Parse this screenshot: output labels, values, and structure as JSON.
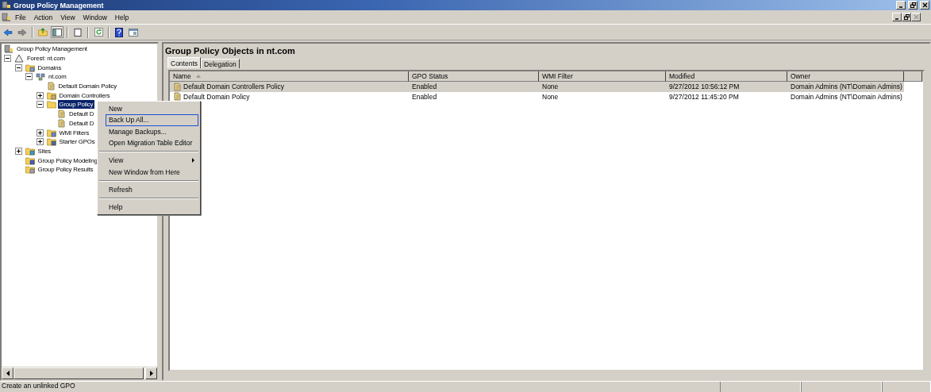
{
  "window": {
    "title": "Group Policy Management"
  },
  "menu_bar": [
    "File",
    "Action",
    "View",
    "Window",
    "Help"
  ],
  "toolbar": [
    {
      "kind": "back"
    },
    {
      "kind": "forward"
    },
    {
      "kind": "separator"
    },
    {
      "kind": "up"
    },
    {
      "kind": "tree",
      "pressed": true
    },
    {
      "kind": "separator"
    },
    {
      "kind": "properties"
    },
    {
      "kind": "separator"
    },
    {
      "kind": "refresh"
    },
    {
      "kind": "separator"
    },
    {
      "kind": "help"
    },
    {
      "kind": "console"
    }
  ],
  "tree": [
    {
      "label": "Group Policy Management",
      "kind": "root",
      "selected": false,
      "children": [
        {
          "label": "Forest: nt.com",
          "kind": "forest",
          "selected": false,
          "expanded": true,
          "children": [
            {
              "label": "Domains",
              "kind": "domains",
              "selected": false,
              "expanded": true,
              "children": [
                {
                  "label": "nt.com",
                  "kind": "domain",
                  "selected": false,
                  "expanded": true,
                  "children": [
                    {
                      "label": "Default Domain Policy",
                      "kind": "link",
                      "selected": false
                    },
                    {
                      "label": "Domain Controllers",
                      "kind": "ou",
                      "selected": false,
                      "expanded": false
                    },
                    {
                      "label": "Group Policy",
                      "kind": "folder",
                      "selected": true,
                      "expanded": true,
                      "children": [
                        {
                          "label": "Default D",
                          "kind": "gpo",
                          "selected": false
                        },
                        {
                          "label": "Default D",
                          "kind": "gpo",
                          "selected": false
                        }
                      ]
                    },
                    {
                      "label": "WMI Filters",
                      "kind": "wmi",
                      "selected": false,
                      "expanded": false
                    },
                    {
                      "label": "Starter GPOs",
                      "kind": "starter",
                      "selected": false,
                      "expanded": false
                    }
                  ]
                }
              ]
            },
            {
              "label": "Sites",
              "kind": "sites",
              "selected": false,
              "expanded": false
            },
            {
              "label": "Group Policy Modeling",
              "kind": "modeling",
              "selected": false
            },
            {
              "label": "Group Policy Results",
              "kind": "results",
              "selected": false
            }
          ]
        }
      ]
    }
  ],
  "context_menu": [
    {
      "kind": "item",
      "label": "New",
      "focused": false,
      "submenu": false
    },
    {
      "kind": "item",
      "label": "Back Up All...",
      "focused": true,
      "submenu": false
    },
    {
      "kind": "item",
      "label": "Manage Backups...",
      "focused": false,
      "submenu": false
    },
    {
      "kind": "item",
      "label": "Open Migration Table Editor",
      "focused": false,
      "submenu": false
    },
    {
      "kind": "separator"
    },
    {
      "kind": "item",
      "label": "View",
      "focused": false,
      "submenu": true
    },
    {
      "kind": "item",
      "label": "New Window from Here",
      "focused": false,
      "submenu": false
    },
    {
      "kind": "separator"
    },
    {
      "kind": "item",
      "label": "Refresh",
      "focused": false,
      "submenu": false
    },
    {
      "kind": "separator"
    },
    {
      "kind": "item",
      "label": "Help",
      "focused": false,
      "submenu": false
    }
  ],
  "details": {
    "title": "Group Policy Objects in nt.com",
    "tabs": [
      {
        "label": "Contents",
        "selected": true
      },
      {
        "label": "Delegation",
        "selected": false
      }
    ],
    "columns": [
      {
        "label": "Name",
        "sorted": true
      },
      {
        "label": "GPO Status",
        "sorted": false
      },
      {
        "label": "WMI Filter",
        "sorted": false
      },
      {
        "label": "Modified",
        "sorted": false
      },
      {
        "label": "Owner",
        "sorted": false
      }
    ],
    "rows": [
      {
        "selected": true,
        "cells": [
          "Default Domain Controllers Policy",
          "Enabled",
          "None",
          "9/27/2012 10:56:12 PM",
          "Domain Admins (NT\\Domain Admins)"
        ]
      },
      {
        "selected": false,
        "cells": [
          "Default Domain Policy",
          "Enabled",
          "None",
          "9/27/2012 11:45:20 PM",
          "Domain Admins (NT\\Domain Admins)"
        ]
      }
    ]
  },
  "status_bar": {
    "text": "Create an unlinked GPO"
  }
}
